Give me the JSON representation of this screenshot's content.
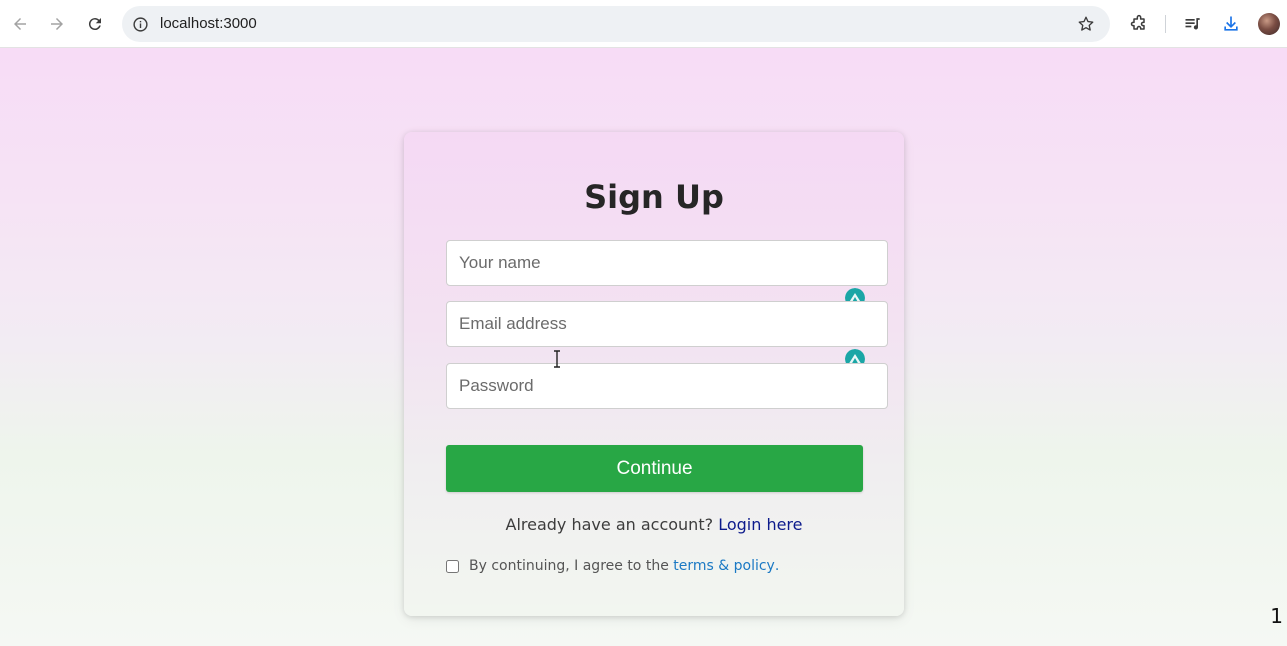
{
  "browser": {
    "url": "localhost:3000",
    "icons": [
      "back-icon",
      "forward-icon",
      "reload-icon",
      "site-info-icon",
      "bookmark-star-icon",
      "extensions-icon",
      "media-control-icon",
      "download-icon",
      "profile-avatar"
    ]
  },
  "form": {
    "title": "Sign Up",
    "name_placeholder": "Your name",
    "email_placeholder": "Email address",
    "password_placeholder": "Password",
    "continue_label": "Continue",
    "login_prompt": "Already have an account?",
    "login_link": "Login here",
    "terms_text": "By continuing, I agree to the",
    "terms_link": "terms & policy",
    "terms_period": "."
  },
  "page": {
    "corner_number": "1"
  },
  "colors": {
    "primary_button": "#28a745",
    "login_link": "#0d1b8c",
    "terms_link": "#1b79c4"
  }
}
